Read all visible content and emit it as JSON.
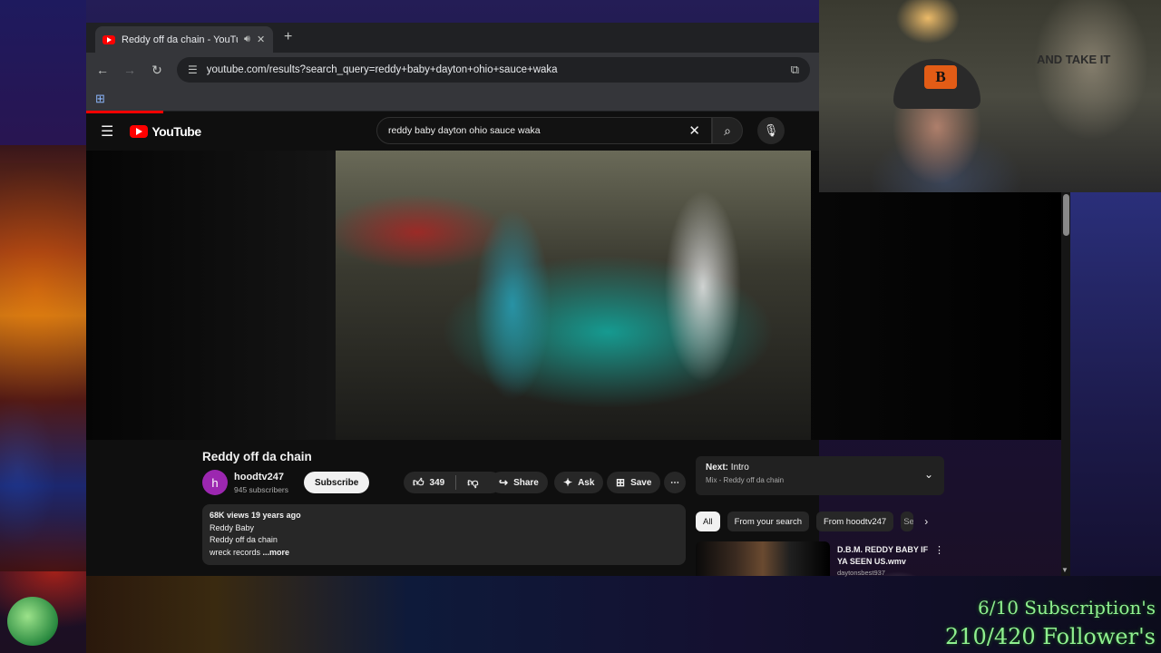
{
  "browser": {
    "tab_title": "Reddy off da chain - YouTube",
    "url": "youtube.com/results?search_query=reddy+baby+dayton+ohio+sauce+waka"
  },
  "youtube": {
    "logo_text": "YouTube",
    "search_query": "reddy baby dayton ohio sauce waka"
  },
  "video": {
    "title": "Reddy off da chain",
    "channel_initial": "h",
    "channel_name": "hoodtv247",
    "channel_subs": "945 subscribers",
    "subscribe_label": "Subscribe",
    "like_count": "349",
    "share_label": "Share",
    "ask_label": "Ask",
    "save_label": "Save",
    "description": {
      "meta": "68K views  19 years ago",
      "line1": "Reddy Baby",
      "line2": "Reddy off da chain",
      "line3": "wreck records",
      "more": "...more"
    }
  },
  "up_next": {
    "label": "Next:",
    "title": "Intro",
    "subtitle": "Mix - Reddy off da chain"
  },
  "chips": [
    "All",
    "From your search",
    "From hoodtv247",
    "Se"
  ],
  "recommendation": {
    "title": "D.B.M. REDDY BABY IF YA SEEN US.wmv",
    "channel": "daytonsbest937"
  },
  "stream_overlay": {
    "subscriptions": "6/10 Subscription's",
    "followers": "210/420 Follower's"
  },
  "webcam": {
    "cap_logo": "B",
    "flag_text": "AND TAKE IT"
  }
}
